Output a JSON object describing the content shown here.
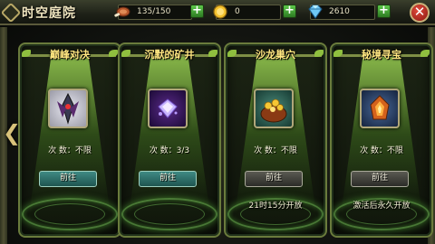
{
  "header": {
    "title": "时空庭院",
    "resources": [
      {
        "name": "stamina",
        "icon": "meat-icon",
        "value": "135/150"
      },
      {
        "name": "gold",
        "icon": "gold-coin-icon",
        "value": "0"
      },
      {
        "name": "diamond",
        "icon": "diamond-icon",
        "value": "2610"
      }
    ],
    "plus_label": "+",
    "close_label": "✕"
  },
  "nav": {
    "left_arrow": "❮",
    "right_arrow": "❯"
  },
  "cards": [
    {
      "title": "巅峰对决",
      "icon": "sword-crest-icon",
      "count": "次  数：不限",
      "button": "前往",
      "button_style": "teal",
      "note": ""
    },
    {
      "title": "沉默的矿井",
      "icon": "purple-crystal-icon",
      "count": "次  数：3/3",
      "button": "前往",
      "button_style": "teal",
      "note": ""
    },
    {
      "title": "沙龙巢穴",
      "icon": "gold-treasure-icon",
      "count": "次  数：不限",
      "button": "前往",
      "button_style": "gray",
      "note": "21时15分开放"
    },
    {
      "title": "秘境寻宝",
      "icon": "fire-stone-icon",
      "count": "次  数：不限",
      "button": "前往",
      "button_style": "gray",
      "note": "激活后永久开放"
    }
  ]
}
